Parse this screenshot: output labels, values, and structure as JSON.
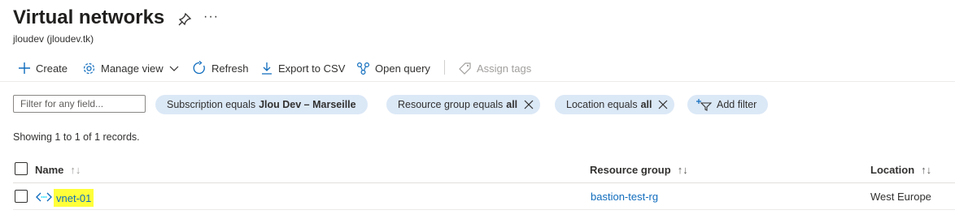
{
  "header": {
    "title": "Virtual networks",
    "subtitle": "jloudev (jloudev.tk)",
    "more_label": "···"
  },
  "toolbar": {
    "create": "Create",
    "manage_view": "Manage view",
    "refresh": "Refresh",
    "export": "Export to CSV",
    "open_query": "Open query",
    "assign_tags": "Assign tags"
  },
  "filters": {
    "placeholder": "Filter for any field...",
    "subscription": {
      "label": "Subscription equals",
      "value": "Jlou Dev – Marseille"
    },
    "resource_group": {
      "label": "Resource group equals",
      "value": "all"
    },
    "location": {
      "label": "Location equals",
      "value": "all"
    },
    "add_filter": "Add filter"
  },
  "records_text": "Showing 1 to 1 of 1 records.",
  "table": {
    "columns": {
      "name": "Name",
      "resource_group": "Resource group",
      "location": "Location"
    },
    "sort_glyph": "↑↓",
    "rows": [
      {
        "name": "vnet-01",
        "resource_group": "bastion-test-rg",
        "location": "West Europe"
      }
    ]
  },
  "colors": {
    "link": "#0f6cbd",
    "pill_bg": "#dbe8f6",
    "highlight": "#ffff3a"
  }
}
